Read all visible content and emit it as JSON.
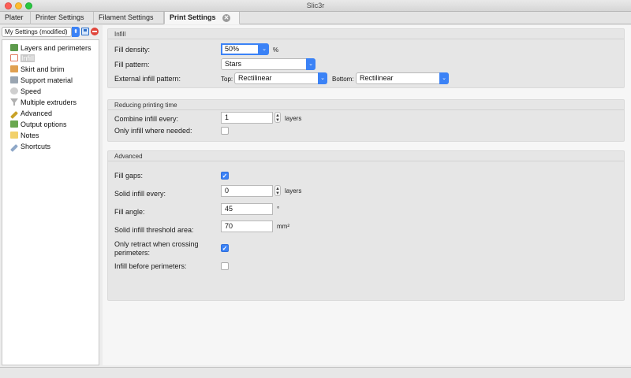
{
  "window": {
    "title": "Slic3r"
  },
  "tabs": [
    {
      "label": "Plater"
    },
    {
      "label": "Printer Settings"
    },
    {
      "label": "Filament Settings"
    },
    {
      "label": "Print Settings",
      "active": true
    }
  ],
  "tab_close_glyph": "✕",
  "preset": {
    "selected": "My Settings (modified)"
  },
  "nav": {
    "items": [
      {
        "label": "Layers and perimeters",
        "icon": "layers-icon"
      },
      {
        "label": "Infill",
        "icon": "infill-icon",
        "selected": true
      },
      {
        "label": "Skirt and brim",
        "icon": "skirt-brim-icon"
      },
      {
        "label": "Support material",
        "icon": "support-material-icon"
      },
      {
        "label": "Speed",
        "icon": "speed-icon"
      },
      {
        "label": "Multiple extruders",
        "icon": "funnel-icon"
      },
      {
        "label": "Advanced",
        "icon": "wrench-icon"
      },
      {
        "label": "Output options",
        "icon": "output-icon"
      },
      {
        "label": "Notes",
        "icon": "note-icon"
      },
      {
        "label": "Shortcuts",
        "icon": "shortcuts-icon"
      }
    ]
  },
  "infill": {
    "title": "Infill",
    "fill_density": {
      "label": "Fill density:",
      "value": "50%",
      "unit": "%"
    },
    "fill_pattern": {
      "label": "Fill pattern:",
      "value": "Stars"
    },
    "external_pattern": {
      "label": "External infill pattern:",
      "top_label": "Top:",
      "top_value": "Rectilinear",
      "bottom_label": "Bottom:",
      "bottom_value": "Rectilinear"
    }
  },
  "reducing": {
    "title": "Reducing printing time",
    "combine": {
      "label": "Combine infill every:",
      "value": "1",
      "unit": "layers"
    },
    "only_where_needed": {
      "label": "Only infill where needed:",
      "checked": false
    }
  },
  "advanced": {
    "title": "Advanced",
    "fill_gaps": {
      "label": "Fill gaps:",
      "checked": true
    },
    "solid_every": {
      "label": "Solid infill every:",
      "value": "0",
      "unit": "layers"
    },
    "fill_angle": {
      "label": "Fill angle:",
      "value": "45",
      "unit": "°"
    },
    "solid_threshold": {
      "label": "Solid infill threshold area:",
      "value": "70",
      "unit": "mm²"
    },
    "only_retract": {
      "label_line1": "Only retract when crossing",
      "label_line2": "perimeters:",
      "checked": true
    },
    "infill_before": {
      "label": "Infill before perimeters:",
      "checked": false
    }
  },
  "colors": {
    "accent": "#3b82f6",
    "traffic_close": "#fd5f57",
    "traffic_min": "#febc2e",
    "traffic_max": "#28c840"
  }
}
